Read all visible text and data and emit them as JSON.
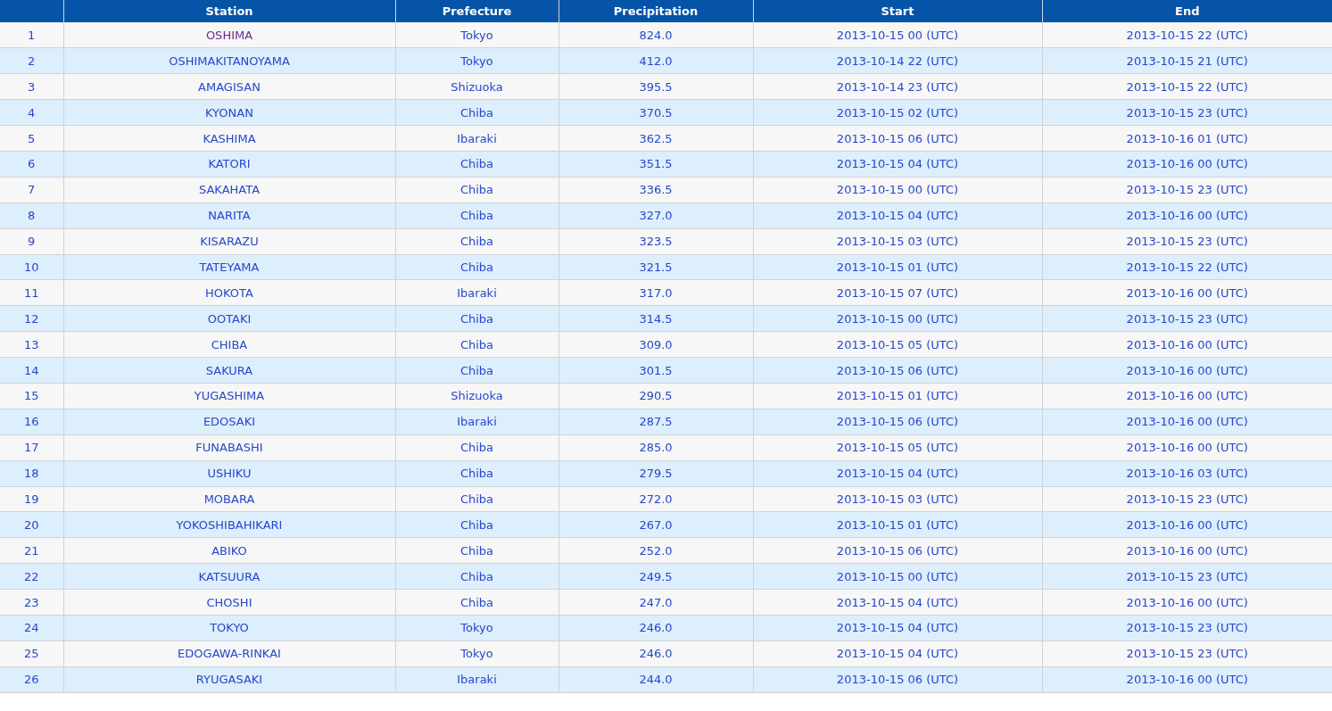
{
  "table": {
    "columns": [
      "",
      "Station",
      "Prefecture",
      "Precipitation",
      "Start",
      "End"
    ],
    "rows": [
      {
        "rank": "1",
        "station": "OSHIMA",
        "visited": true,
        "prefecture": "Tokyo",
        "precipitation": "824.0",
        "start": "2013-10-15 00 (UTC)",
        "end": "2013-10-15 22 (UTC)"
      },
      {
        "rank": "2",
        "station": "OSHIMAKITANOYAMA",
        "visited": false,
        "prefecture": "Tokyo",
        "precipitation": "412.0",
        "start": "2013-10-14 22 (UTC)",
        "end": "2013-10-15 21 (UTC)"
      },
      {
        "rank": "3",
        "station": "AMAGISAN",
        "visited": false,
        "prefecture": "Shizuoka",
        "precipitation": "395.5",
        "start": "2013-10-14 23 (UTC)",
        "end": "2013-10-15 22 (UTC)"
      },
      {
        "rank": "4",
        "station": "KYONAN",
        "visited": false,
        "prefecture": "Chiba",
        "precipitation": "370.5",
        "start": "2013-10-15 02 (UTC)",
        "end": "2013-10-15 23 (UTC)"
      },
      {
        "rank": "5",
        "station": "KASHIMA",
        "visited": false,
        "prefecture": "Ibaraki",
        "precipitation": "362.5",
        "start": "2013-10-15 06 (UTC)",
        "end": "2013-10-16 01 (UTC)"
      },
      {
        "rank": "6",
        "station": "KATORI",
        "visited": false,
        "prefecture": "Chiba",
        "precipitation": "351.5",
        "start": "2013-10-15 04 (UTC)",
        "end": "2013-10-16 00 (UTC)"
      },
      {
        "rank": "7",
        "station": "SAKAHATA",
        "visited": false,
        "prefecture": "Chiba",
        "precipitation": "336.5",
        "start": "2013-10-15 00 (UTC)",
        "end": "2013-10-15 23 (UTC)"
      },
      {
        "rank": "8",
        "station": "NARITA",
        "visited": false,
        "prefecture": "Chiba",
        "precipitation": "327.0",
        "start": "2013-10-15 04 (UTC)",
        "end": "2013-10-16 00 (UTC)"
      },
      {
        "rank": "9",
        "station": "KISARAZU",
        "visited": false,
        "prefecture": "Chiba",
        "precipitation": "323.5",
        "start": "2013-10-15 03 (UTC)",
        "end": "2013-10-15 23 (UTC)"
      },
      {
        "rank": "10",
        "station": "TATEYAMA",
        "visited": false,
        "prefecture": "Chiba",
        "precipitation": "321.5",
        "start": "2013-10-15 01 (UTC)",
        "end": "2013-10-15 22 (UTC)"
      },
      {
        "rank": "11",
        "station": "HOKOTA",
        "visited": false,
        "prefecture": "Ibaraki",
        "precipitation": "317.0",
        "start": "2013-10-15 07 (UTC)",
        "end": "2013-10-16 00 (UTC)"
      },
      {
        "rank": "12",
        "station": "OOTAKI",
        "visited": false,
        "prefecture": "Chiba",
        "precipitation": "314.5",
        "start": "2013-10-15 00 (UTC)",
        "end": "2013-10-15 23 (UTC)"
      },
      {
        "rank": "13",
        "station": "CHIBA",
        "visited": false,
        "prefecture": "Chiba",
        "precipitation": "309.0",
        "start": "2013-10-15 05 (UTC)",
        "end": "2013-10-16 00 (UTC)"
      },
      {
        "rank": "14",
        "station": "SAKURA",
        "visited": false,
        "prefecture": "Chiba",
        "precipitation": "301.5",
        "start": "2013-10-15 06 (UTC)",
        "end": "2013-10-16 00 (UTC)"
      },
      {
        "rank": "15",
        "station": "YUGASHIMA",
        "visited": false,
        "prefecture": "Shizuoka",
        "precipitation": "290.5",
        "start": "2013-10-15 01 (UTC)",
        "end": "2013-10-16 00 (UTC)"
      },
      {
        "rank": "16",
        "station": "EDOSAKI",
        "visited": false,
        "prefecture": "Ibaraki",
        "precipitation": "287.5",
        "start": "2013-10-15 06 (UTC)",
        "end": "2013-10-16 00 (UTC)"
      },
      {
        "rank": "17",
        "station": "FUNABASHI",
        "visited": false,
        "prefecture": "Chiba",
        "precipitation": "285.0",
        "start": "2013-10-15 05 (UTC)",
        "end": "2013-10-16 00 (UTC)"
      },
      {
        "rank": "18",
        "station": "USHIKU",
        "visited": false,
        "prefecture": "Chiba",
        "precipitation": "279.5",
        "start": "2013-10-15 04 (UTC)",
        "end": "2013-10-16 03 (UTC)"
      },
      {
        "rank": "19",
        "station": "MOBARA",
        "visited": false,
        "prefecture": "Chiba",
        "precipitation": "272.0",
        "start": "2013-10-15 03 (UTC)",
        "end": "2013-10-15 23 (UTC)"
      },
      {
        "rank": "20",
        "station": "YOKOSHIBAHIKARI",
        "visited": false,
        "prefecture": "Chiba",
        "precipitation": "267.0",
        "start": "2013-10-15 01 (UTC)",
        "end": "2013-10-16 00 (UTC)"
      },
      {
        "rank": "21",
        "station": "ABIKO",
        "visited": false,
        "prefecture": "Chiba",
        "precipitation": "252.0",
        "start": "2013-10-15 06 (UTC)",
        "end": "2013-10-16 00 (UTC)"
      },
      {
        "rank": "22",
        "station": "KATSUURA",
        "visited": false,
        "prefecture": "Chiba",
        "precipitation": "249.5",
        "start": "2013-10-15 00 (UTC)",
        "end": "2013-10-15 23 (UTC)"
      },
      {
        "rank": "23",
        "station": "CHOSHI",
        "visited": false,
        "prefecture": "Chiba",
        "precipitation": "247.0",
        "start": "2013-10-15 04 (UTC)",
        "end": "2013-10-16 00 (UTC)"
      },
      {
        "rank": "24",
        "station": "TOKYO",
        "visited": false,
        "prefecture": "Tokyo",
        "precipitation": "246.0",
        "start": "2013-10-15 04 (UTC)",
        "end": "2013-10-15 23 (UTC)"
      },
      {
        "rank": "25",
        "station": "EDOGAWA-RINKAI",
        "visited": false,
        "prefecture": "Tokyo",
        "precipitation": "246.0",
        "start": "2013-10-15 04 (UTC)",
        "end": "2013-10-15 23 (UTC)"
      },
      {
        "rank": "26",
        "station": "RYUGASAKI",
        "visited": false,
        "prefecture": "Ibaraki",
        "precipitation": "244.0",
        "start": "2013-10-15 06 (UTC)",
        "end": "2013-10-16 00 (UTC)"
      }
    ]
  }
}
